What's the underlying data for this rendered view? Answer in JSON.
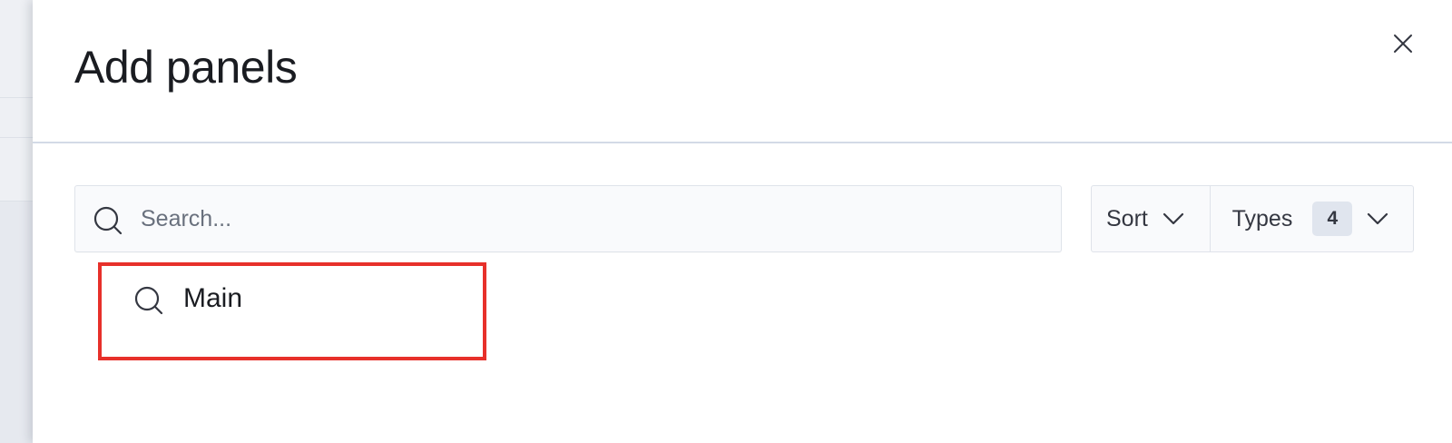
{
  "flyout": {
    "title": "Add panels",
    "close_icon": "close-icon"
  },
  "search": {
    "placeholder": "Search...",
    "value": "",
    "icon": "search-icon"
  },
  "filters": {
    "sort_label": "Sort",
    "types_label": "Types",
    "types_count": "4",
    "chevron_icon": "chevron-down-icon"
  },
  "results": [
    {
      "label": "Main",
      "icon": "search-icon"
    }
  ],
  "colors": {
    "highlight": "#e7302a",
    "divider": "#d3dae6",
    "text": "#1a1c21",
    "badge_bg": "#e0e5ee"
  }
}
